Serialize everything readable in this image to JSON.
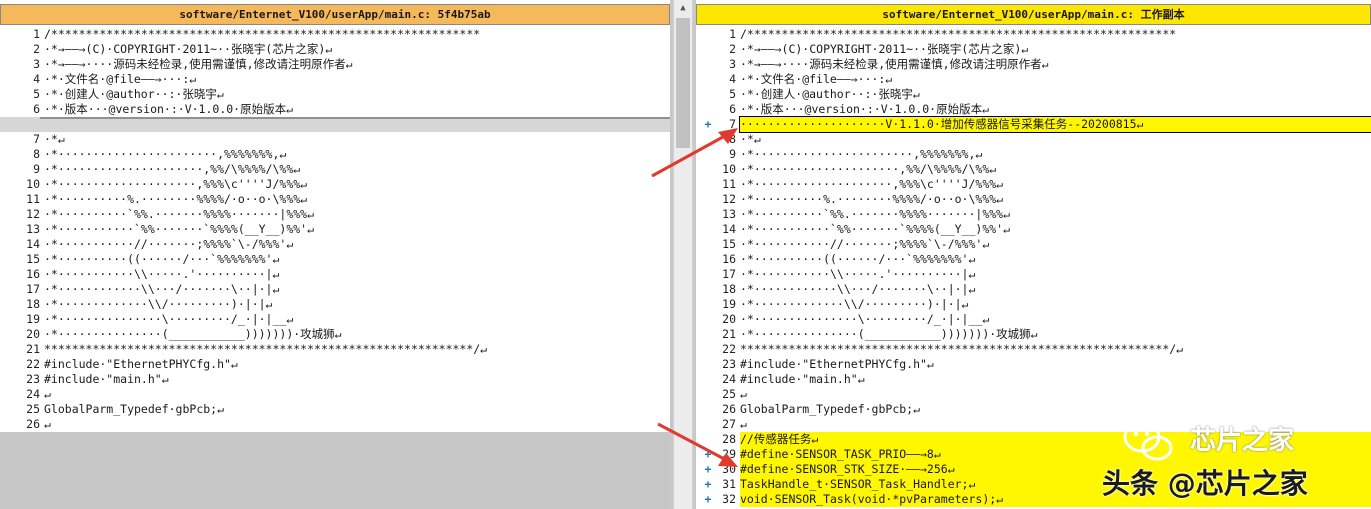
{
  "left_pane": {
    "title": "software/Enternet_V100/userApp/main.c: 5f4b75ab",
    "lines": [
      {
        "num": "1",
        "text": "/**************************************************************"
      },
      {
        "num": "2",
        "text": "·*→——→(C)·COPYRIGHT·2011~··张晓宇(芯片之家)↵"
      },
      {
        "num": "3",
        "text": "·*→——→····源码未经检录,使用需谨慎,修改请注明原作者↵"
      },
      {
        "num": "4",
        "text": "·*·文件名·@file——→···:↵"
      },
      {
        "num": "5",
        "text": "·*·创建人·@author··:·张晓宇↵"
      },
      {
        "num": "6",
        "text": "·*·版本···@version·:·V·1.0.0·原始版本↵"
      },
      {
        "num": "7",
        "text": "·*↵"
      },
      {
        "num": "8",
        "text": "·*·······················,%%%%%%%,↵"
      },
      {
        "num": "9",
        "text": "·*·····················,%%/\\%%%%/\\%%↵"
      },
      {
        "num": "10",
        "text": "·*····················,%%%\\c''''J/%%%↵"
      },
      {
        "num": "11",
        "text": "·*··········%.········%%%%/·o··o·\\%%%↵"
      },
      {
        "num": "12",
        "text": "·*··········`%%.·······%%%%·······|%%%↵"
      },
      {
        "num": "13",
        "text": "·*···········`%%·······`%%%%(__Y__)%%'↵"
      },
      {
        "num": "14",
        "text": "·*···········//·······;%%%%`\\-/%%%'↵"
      },
      {
        "num": "15",
        "text": "·*··········((······/···`%%%%%%%'↵"
      },
      {
        "num": "16",
        "text": "·*···········\\\\·····.'··········|↵"
      },
      {
        "num": "17",
        "text": "·*············\\\\···/·······\\··|·|↵"
      },
      {
        "num": "18",
        "text": "·*·············\\\\/·········)·|·|↵"
      },
      {
        "num": "19",
        "text": "·*···············\\·········/_·|·|__↵"
      },
      {
        "num": "20",
        "text": "·*···············(___________)))))))·攻城狮↵"
      },
      {
        "num": "21",
        "text": "**************************************************************/↵"
      },
      {
        "num": "22",
        "text": "#include·\"EthernetPHYCfg.h\"↵"
      },
      {
        "num": "23",
        "text": "#include·\"main.h\"↵"
      },
      {
        "num": "24",
        "text": "↵"
      },
      {
        "num": "25",
        "text": "GlobalParm_Typedef·gbPcb;↵"
      },
      {
        "num": "26",
        "text": "↵"
      }
    ]
  },
  "right_pane": {
    "title": "software/Enternet_V100/userApp/main.c: 工作副本",
    "added_marker": "+",
    "lines": [
      {
        "num": "1",
        "text": "/**************************************************************"
      },
      {
        "num": "2",
        "text": "·*→——→(C)·COPYRIGHT·2011~··张晓宇(芯片之家)↵"
      },
      {
        "num": "3",
        "text": "·*→——→····源码未经检录,使用需谨慎,修改请注明原作者↵"
      },
      {
        "num": "4",
        "text": "·*·文件名·@file——→···:↵"
      },
      {
        "num": "5",
        "text": "·*·创建人·@author··:·张晓宇↵"
      },
      {
        "num": "6",
        "text": "·*·版本···@version·:·V·1.0.0·原始版本↵"
      },
      {
        "num": "7",
        "text": "·····················V·1.1.0·增加传感器信号采集任务--20200815↵"
      },
      {
        "num": "8",
        "text": "·*↵"
      },
      {
        "num": "9",
        "text": "·*·······················,%%%%%%%,↵"
      },
      {
        "num": "10",
        "text": "·*·····················,%%/\\%%%%/\\%%↵"
      },
      {
        "num": "11",
        "text": "·*····················,%%%\\c''''J/%%%↵"
      },
      {
        "num": "12",
        "text": "·*··········%.········%%%%/·o··o·\\%%%↵"
      },
      {
        "num": "13",
        "text": "·*··········`%%.·······%%%%·······|%%%↵"
      },
      {
        "num": "14",
        "text": "·*···········`%%·······`%%%%(__Y__)%%'↵"
      },
      {
        "num": "15",
        "text": "·*···········//·······;%%%%`\\-/%%%'↵"
      },
      {
        "num": "16",
        "text": "·*··········((······/···`%%%%%%%'↵"
      },
      {
        "num": "17",
        "text": "·*···········\\\\·····.'··········|↵"
      },
      {
        "num": "18",
        "text": "·*············\\\\···/·······\\··|·|↵"
      },
      {
        "num": "19",
        "text": "·*·············\\\\/·········)·|·|↵"
      },
      {
        "num": "20",
        "text": "·*···············\\·········/_·|·|__↵"
      },
      {
        "num": "21",
        "text": "·*···············(___________)))))))·攻城狮↵"
      },
      {
        "num": "22",
        "text": "**************************************************************/↵"
      },
      {
        "num": "23",
        "text": "#include·\"EthernetPHYCfg.h\"↵"
      },
      {
        "num": "24",
        "text": "#include·\"main.h\"↵"
      },
      {
        "num": "25",
        "text": "↵"
      },
      {
        "num": "26",
        "text": "GlobalParm_Typedef·gbPcb;↵"
      },
      {
        "num": "27",
        "text": "↵"
      },
      {
        "num": "28",
        "text": "//传感器任务↵"
      },
      {
        "num": "29",
        "text": "#define·SENSOR_TASK_PRIO——→8↵"
      },
      {
        "num": "30",
        "text": "#define·SENSOR_STK_SIZE·——→256↵"
      },
      {
        "num": "31",
        "text": "TaskHandle_t·SENSOR_Task_Handler;↵"
      },
      {
        "num": "32",
        "text": "void·SENSOR_Task(void·*pvParameters);↵"
      }
    ]
  },
  "watermark": {
    "top_text": "芯片之家",
    "bottom_text": "头条 @芯片之家"
  },
  "colors": {
    "left_title_bg": "#f5b85a",
    "right_title_bg": "#fde700",
    "added_line_bg": "#fff700",
    "added_marker": "#1f74c0",
    "arrow": "#e03a2e"
  }
}
